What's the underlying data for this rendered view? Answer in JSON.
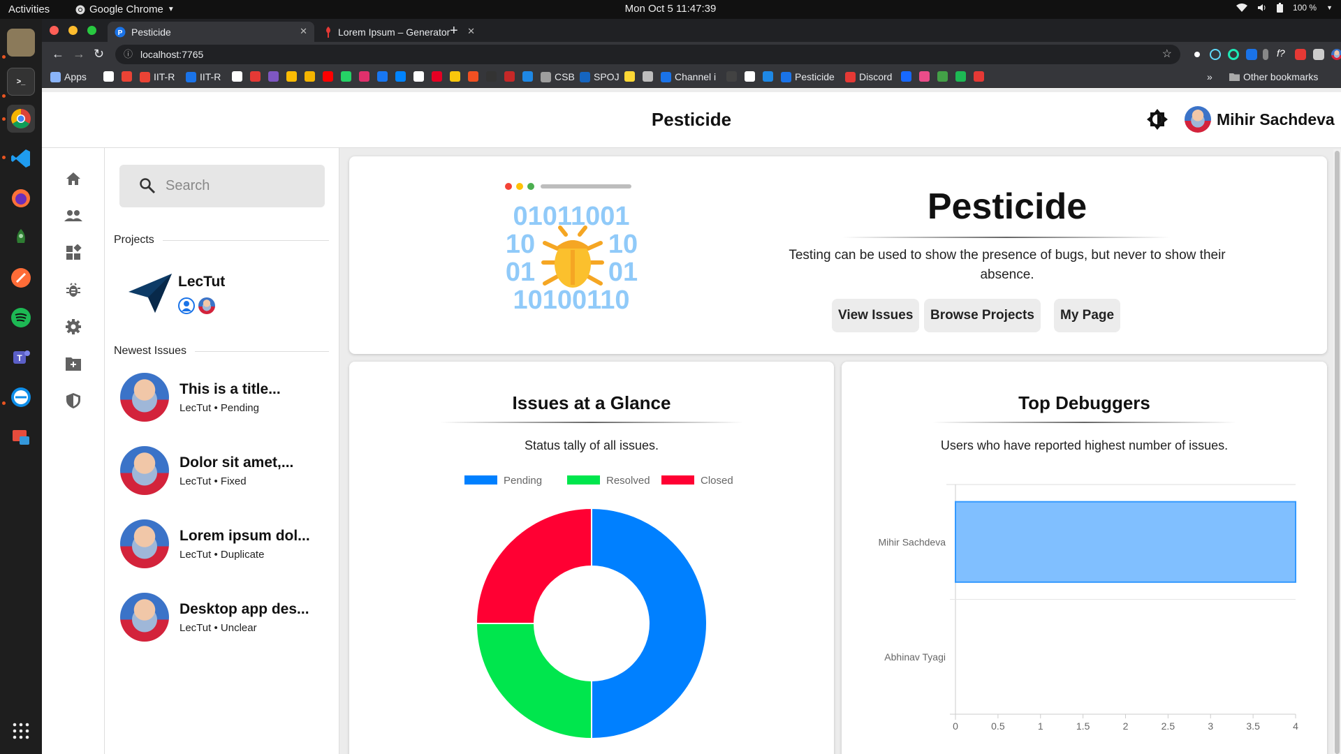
{
  "os": {
    "activities_label": "Activities",
    "active_app_label": "Google Chrome",
    "clock": "Mon Oct 5  11:47:39",
    "volume_label": "100 %"
  },
  "browser": {
    "tabs": [
      {
        "title": "Pesticide",
        "active": true
      },
      {
        "title": "Lorem Ipsum – Generator",
        "active": false
      }
    ],
    "url": "localhost:7765",
    "bookmarks": [
      {
        "label": "Apps",
        "color": "#8ab4f8"
      },
      {
        "label": "",
        "color": "#ffffff"
      },
      {
        "label": "",
        "color": "#ea4335"
      },
      {
        "label": "IIT-R",
        "color": "#ea4335"
      },
      {
        "label": "IIT-R",
        "color": "#1a73e8"
      },
      {
        "label": "",
        "color": "#ffffff"
      },
      {
        "label": "",
        "color": "#e53935"
      },
      {
        "label": "",
        "color": "#7e57c2"
      },
      {
        "label": "",
        "color": "#fbbc04"
      },
      {
        "label": "",
        "color": "#f4b400"
      },
      {
        "label": "",
        "color": "#ff0000"
      },
      {
        "label": "",
        "color": "#25d366"
      },
      {
        "label": "",
        "color": "#e1306c"
      },
      {
        "label": "",
        "color": "#1877f2"
      },
      {
        "label": "",
        "color": "#0084ff"
      },
      {
        "label": "",
        "color": "#ffffff"
      },
      {
        "label": "",
        "color": "#e60023"
      },
      {
        "label": "",
        "color": "#f9c70c"
      },
      {
        "label": "",
        "color": "#f25022"
      },
      {
        "label": "",
        "color": "#333333"
      },
      {
        "label": "",
        "color": "#c62828"
      },
      {
        "label": "",
        "color": "#1e88e5"
      },
      {
        "label": "CSB",
        "color": "#9e9e9e"
      },
      {
        "label": "SPOJ",
        "color": "#1565c0"
      },
      {
        "label": "",
        "color": "#fdd835"
      },
      {
        "label": "",
        "color": "#bdbdbd"
      },
      {
        "label": "Channel i",
        "color": "#1a73e8"
      },
      {
        "label": "",
        "color": "#424242"
      },
      {
        "label": "",
        "color": "#ffffff"
      },
      {
        "label": "",
        "color": "#1e88e5"
      },
      {
        "label": "Pesticide",
        "color": "#1a73e8"
      },
      {
        "label": "Discord",
        "color": "#e53935"
      },
      {
        "label": "",
        "color": "#1769ff"
      },
      {
        "label": "",
        "color": "#ea4c89"
      },
      {
        "label": "",
        "color": "#43a047"
      },
      {
        "label": "",
        "color": "#1db954"
      },
      {
        "label": "",
        "color": "#e53935"
      }
    ],
    "overflow_label": "»",
    "other_bookmarks_label": "Other bookmarks"
  },
  "app": {
    "header_title": "Pesticide",
    "user_name": "Mihir Sachdeva",
    "nav_icons": [
      "home-icon",
      "people-icon",
      "dashboard-icon",
      "bug-icon",
      "settings-icon",
      "folder-add-icon",
      "shield-icon"
    ],
    "sidebar": {
      "search_placeholder": "Search",
      "projects_heading": "Projects",
      "projects": [
        {
          "name": "LecTut"
        }
      ],
      "issues_heading": "Newest Issues",
      "issues": [
        {
          "title": "This is a title...",
          "project": "LecTut",
          "status": "Pending"
        },
        {
          "title": "Dolor sit amet,...",
          "project": "LecTut",
          "status": "Fixed"
        },
        {
          "title": "Lorem ipsum dol...",
          "project": "LecTut",
          "status": "Duplicate"
        },
        {
          "title": "Desktop app des...",
          "project": "LecTut",
          "status": "Unclear"
        }
      ]
    },
    "hero": {
      "title": "Pesticide",
      "quote": "Testing can be used to show the presence of bugs, but never to show their absence.",
      "buttons": [
        "View Issues",
        "Browse Projects",
        "My Page"
      ],
      "illustration_text": [
        "01011001",
        "10",
        "10",
        "01",
        "01",
        "10100110"
      ]
    },
    "glance_card": {
      "title": "Issues at a Glance",
      "subtitle": "Status tally of all issues."
    },
    "debuggers_card": {
      "title": "Top Debuggers",
      "subtitle": "Users who have reported highest number of issues."
    }
  },
  "chart_data": [
    {
      "type": "pie",
      "variant": "doughnut",
      "categories": [
        "Pending",
        "Resolved",
        "Closed"
      ],
      "values": [
        2,
        1,
        1
      ],
      "colors": [
        "#0080ff",
        "#00e64d",
        "#ff0033"
      ],
      "legend": "top"
    },
    {
      "type": "bar",
      "orientation": "horizontal",
      "categories": [
        "Mihir Sachdeva",
        "Abhinav Tyagi"
      ],
      "values": [
        4,
        0
      ],
      "xlim": [
        0,
        4
      ],
      "x_ticks": [
        "0",
        "0.5",
        "1",
        "1.5",
        "2",
        "2.5",
        "3",
        "3.5",
        "4"
      ],
      "bar_color": "#80bfff",
      "bar_border": "#3399ff"
    }
  ]
}
